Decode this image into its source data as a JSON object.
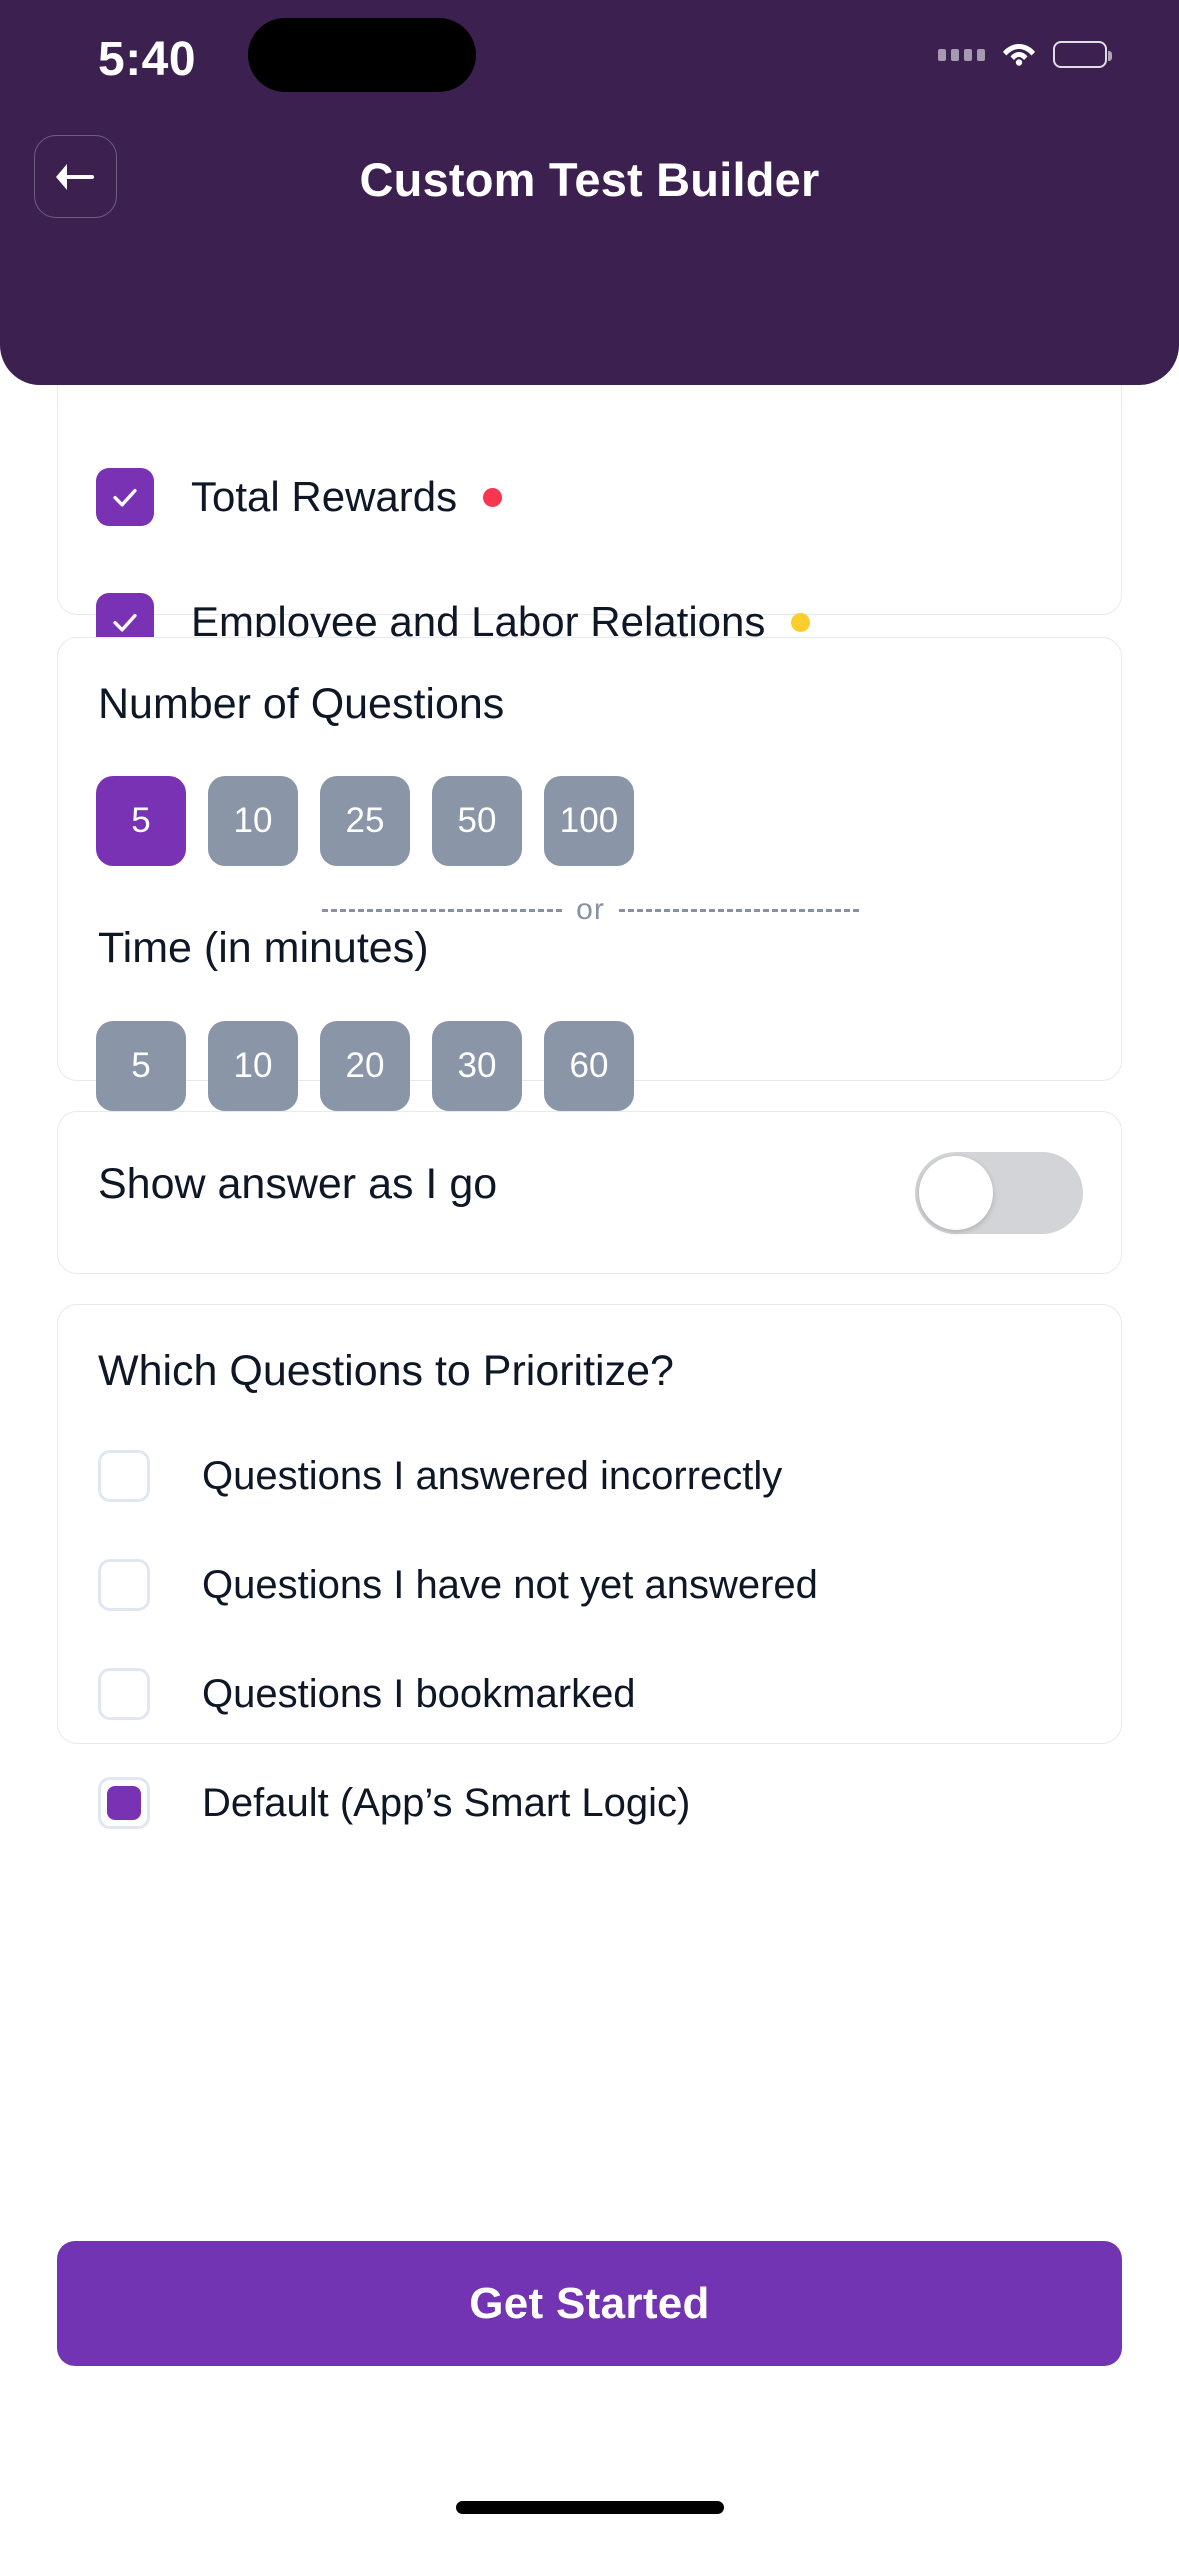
{
  "statusbar": {
    "time": "5:40",
    "signal_icon": "cellular-signal-icon",
    "wifi_icon": "wifi-icon",
    "battery_icon": "battery-full-icon"
  },
  "header": {
    "title": "Custom Test Builder",
    "back_icon": "arrow-left-icon",
    "background_color": "#3B2050"
  },
  "subjects": {
    "items": [
      {
        "label": "Total Rewards",
        "checked": true,
        "dot_color": "#F6374F"
      },
      {
        "label": "Employee and Labor Relations",
        "checked": true,
        "dot_color": "#FBCE2B"
      }
    ]
  },
  "counts": {
    "questions_title": "Number of Questions",
    "questions_options": [
      "5",
      "10",
      "25",
      "50",
      "100"
    ],
    "questions_selected": "5",
    "divider_text": "or",
    "time_title": "Time (in minutes)",
    "time_options": [
      "5",
      "10",
      "20",
      "30",
      "60"
    ],
    "time_selected": ""
  },
  "show_answer": {
    "label": "Show answer as I go",
    "enabled": false
  },
  "priority": {
    "title": "Which Questions to Prioritize?",
    "items": [
      {
        "label": "Questions I answered incorrectly",
        "selected": false
      },
      {
        "label": "Questions I have not yet answered",
        "selected": false
      },
      {
        "label": "Questions I bookmarked",
        "selected": false
      },
      {
        "label": "Default (App’s Smart Logic)",
        "selected": true
      }
    ]
  },
  "cta": {
    "label": "Get Started",
    "color": "#7234B2"
  },
  "theme": {
    "accent_purple": "#7A32B5",
    "header_purple": "#3B2050",
    "pill_gray": "#8A95A7",
    "card_border": "#E4E9F2",
    "text_dark": "#0E1726"
  }
}
